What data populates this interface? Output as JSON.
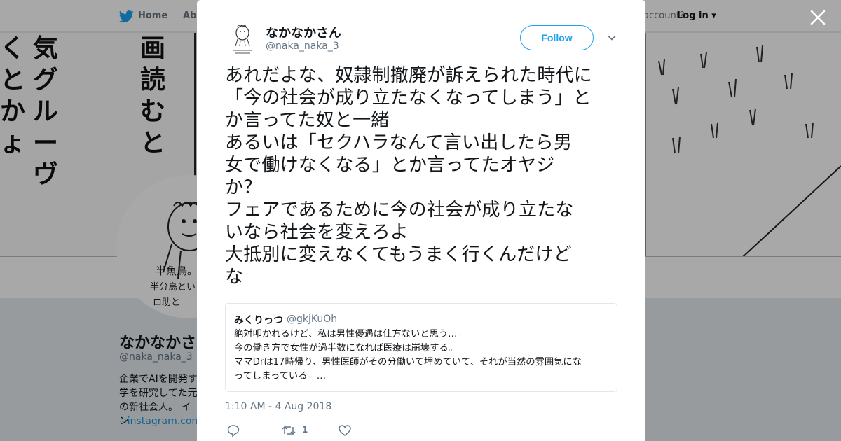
{
  "nav": {
    "home_label": "Home",
    "about_label": "Abo",
    "account_text": "account?",
    "login_label": "Log in"
  },
  "background": {
    "manga_columns": [
      "くとかょ",
      "気グルーヴ",
      "画読むと"
    ],
    "profile_name": "なかなかさ",
    "profile_handle": "@naka_naka_3",
    "bio_lines": [
      "企業でAIを開発す",
      "学を研究してた元",
      "の新社会人。 イン"
    ],
    "bio_link": "→instagram.com/"
  },
  "tweet": {
    "author_name": "なかなかさん",
    "author_handle": "@naka_naka_3",
    "follow_label": "Follow",
    "text_lines": [
      "あれだよな、奴隷制撤廃が訴えられた時代に",
      "「今の社会が成り立たなくなってしまう」と",
      "か言ってた奴と一緒",
      "あるいは「セクハラなんて言い出したら男",
      "女で働けなくなる」とか言ってたオヤジ",
      "か？",
      "フェアであるために今の社会が成り立たな",
      "いなら社会を変えろよ",
      "大抵別に変えなくてもうまく行くんだけど",
      "な"
    ],
    "timestamp": "1:10 AM - 4 Aug 2018",
    "retweet_count": "1"
  },
  "quoted_tweet": {
    "name": "みくりっつ",
    "handle": "@gkjKuOh",
    "body_lines": [
      "絶対叩かれるけど、私は男性優遇は仕方ないと思う…。",
      "今の働き方で女性が過半数になれば医療は崩壊する。",
      "ママDrは17時帰り、男性医師がその分働いて埋めていて、それが当然の雰囲気にな",
      "ってしまっている。…"
    ]
  },
  "icons": {
    "bird": "twitter-bird-icon",
    "close": "close-icon",
    "caret": "chevron-down-icon",
    "reply": "reply-icon",
    "retweet": "retweet-icon",
    "like": "heart-icon"
  },
  "colors": {
    "brand": "#1da1f2",
    "text": "#14171a",
    "secondary_text": "#657786"
  }
}
